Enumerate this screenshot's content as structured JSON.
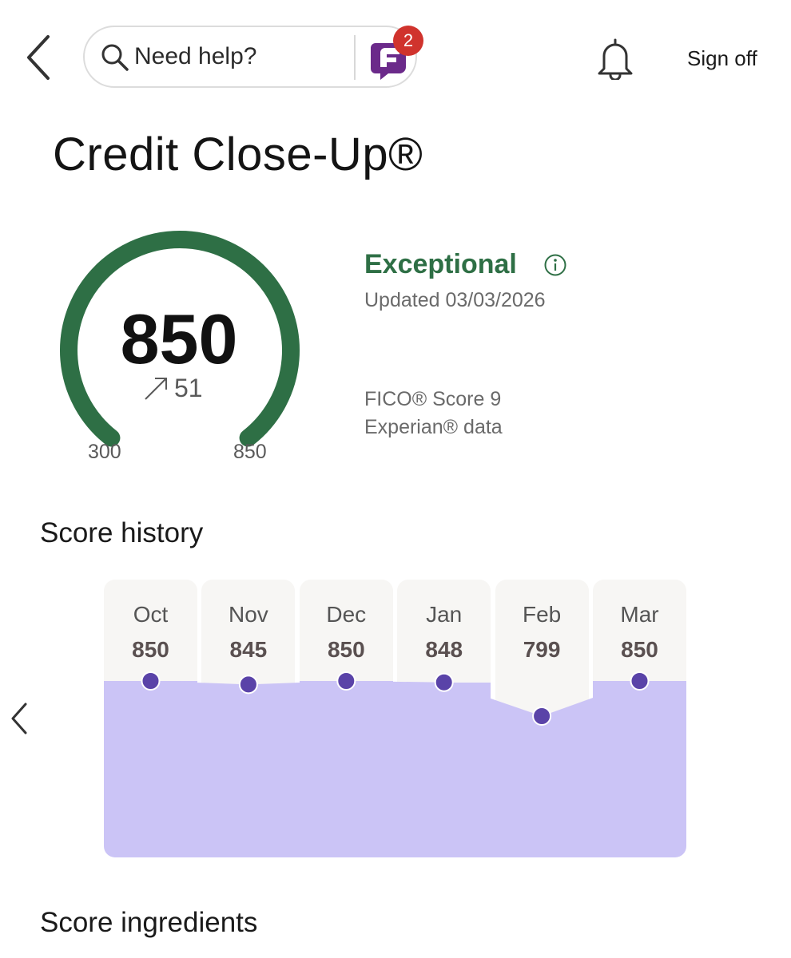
{
  "header": {
    "back_icon": "chevron-left-icon",
    "search_placeholder": "Need help?",
    "search_icon": "search-icon",
    "assistant_icon": "fargo-assistant-icon",
    "notification_count": "2",
    "bell_icon": "bell-icon",
    "signoff_label": "Sign off"
  },
  "page": {
    "title": "Credit Close-Up®"
  },
  "score": {
    "value": "850",
    "change": "51",
    "range_min": "300",
    "range_max": "850",
    "rating": "Exceptional",
    "updated": "Updated 03/03/2026",
    "model": "FICO® Score 9",
    "bureau": "Experian® data",
    "fraction": 1.0
  },
  "history": {
    "title": "Score history",
    "items": [
      {
        "month": "Oct",
        "score": "850"
      },
      {
        "month": "Nov",
        "score": "845"
      },
      {
        "month": "Dec",
        "score": "850"
      },
      {
        "month": "Jan",
        "score": "848"
      },
      {
        "month": "Feb",
        "score": "799"
      },
      {
        "month": "Mar",
        "score": "850"
      }
    ]
  },
  "ingredients": {
    "title": "Score ingredients"
  },
  "colors": {
    "gauge": "#2e6f45",
    "rating": "#2e6f45",
    "history_fill": "#cbc4f6",
    "history_dot": "#5a43a8",
    "badge": "#d0332d",
    "assistant": "#6b2a8a"
  }
}
